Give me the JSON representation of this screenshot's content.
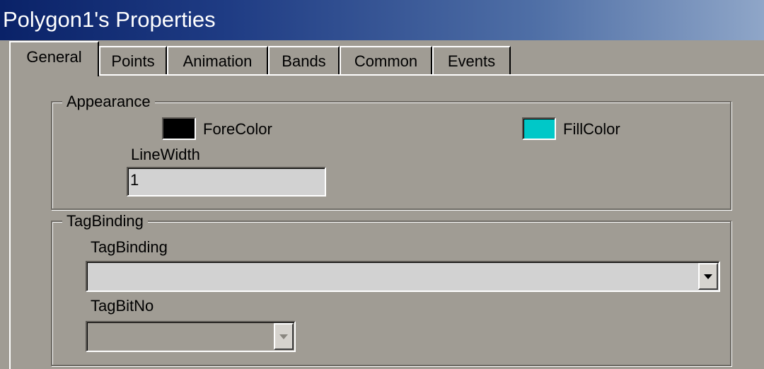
{
  "window": {
    "title": "Polygon1's Properties"
  },
  "tabs": [
    {
      "label": "General",
      "active": true
    },
    {
      "label": "Points",
      "active": false
    },
    {
      "label": "Animation",
      "active": false
    },
    {
      "label": "Bands",
      "active": false
    },
    {
      "label": "Common",
      "active": false
    },
    {
      "label": "Events",
      "active": false
    }
  ],
  "appearance": {
    "legend": "Appearance",
    "fore_color": {
      "label": "ForeColor",
      "value": "#000000"
    },
    "fill_color": {
      "label": "FillColor",
      "value": "#00c8c8"
    },
    "line_width": {
      "label": "LineWidth",
      "value": "1"
    }
  },
  "tag_binding_group": {
    "legend": "TagBinding",
    "tag_binding": {
      "label": "TagBinding",
      "value": ""
    },
    "tag_bit_no": {
      "label": "TagBitNo",
      "value": "",
      "enabled": false
    }
  }
}
